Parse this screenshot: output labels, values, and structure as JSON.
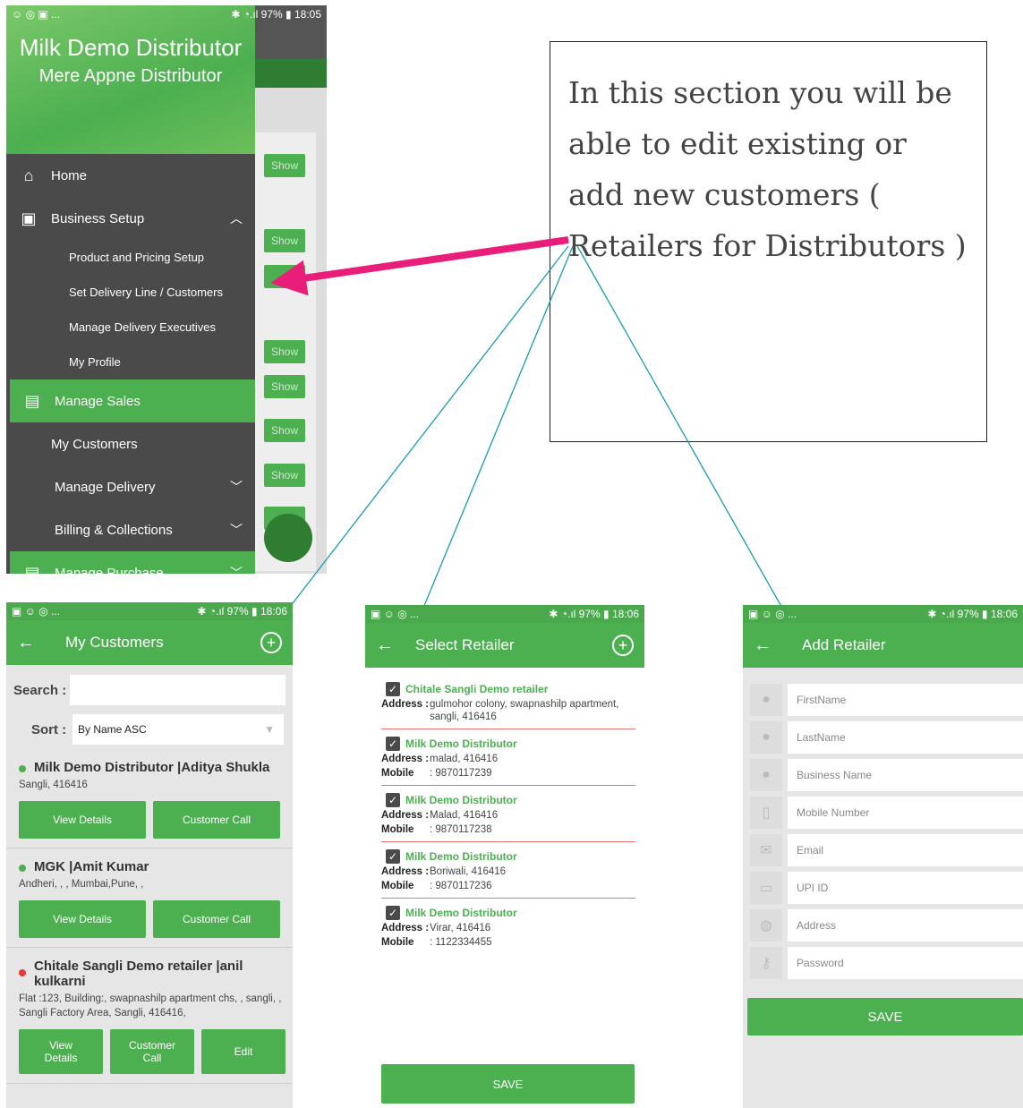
{
  "drawer_screen": {
    "status_left": "☺ ◎ ▣ ...",
    "status_right": "✱ ◔.ıl 97% ▮ 18:05",
    "header_title": "Milk  Demo Distributor",
    "header_subtitle": "Mere Appne Distributor",
    "show_label": "Show",
    "items": {
      "home": "Home",
      "business_setup": "Business Setup",
      "product_pricing": "Product and Pricing Setup",
      "delivery_line": "Set Delivery Line / Customers",
      "delivery_execs": "Manage Delivery Executives",
      "my_profile": "My Profile",
      "manage_sales": "Manage Sales",
      "my_customers": "My Customers",
      "manage_delivery": "Manage Delivery",
      "billing": "Billing & Collections",
      "manage_purchase": "Manage Purchase"
    }
  },
  "note": "In this section you will be able to edit existing or add new customers ( Retailers for Distributors )",
  "customers_screen": {
    "status_left": "▣ ☺ ◎ ...",
    "status_right": "✱ ◔.ıl 97% ▮ 18:06",
    "title": "My Customers",
    "search_label": "Search :",
    "sort_label": "Sort :",
    "sort_value": "By Name ASC",
    "customers": [
      {
        "name": "Milk  Demo Distributor |Aditya Shukla",
        "address": "Sangli, 416416",
        "status_color": "#4caf50",
        "btn1": "View Details",
        "btn2": "Customer Call"
      },
      {
        "name": "MGK |Amit Kumar",
        "address": "Andheri, , , Mumbai,Pune, ,",
        "status_color": "#4caf50",
        "btn1": "View Details",
        "btn2": "Customer Call"
      },
      {
        "name": "Chitale Sangli Demo retailer |anil kulkarni",
        "address": "Flat :123, Building:, swapnashilp apartment chs, , sangli, , Sangli Factory Area, Sangli, 416416,",
        "status_color": "#e53935",
        "btn1": "View\nDetails",
        "btn2": "Customer\nCall",
        "btn3": "Edit"
      }
    ]
  },
  "select_screen": {
    "status_left": "▣ ☺ ◎ ...",
    "status_right": "✱ ◔.ıl 97% ▮ 18:06",
    "title": "Select Retailer",
    "address_label": "Address :",
    "mobile_label": "Mobile",
    "retailers": [
      {
        "name": "Chitale Sangli Demo retailer",
        "address": "gulmohor colony, swapnashilp apartment, sangli, 416416",
        "mobile": ""
      },
      {
        "name": "Milk  Demo Distributor",
        "address": "malad, 416416",
        "mobile": ": 9870117239"
      },
      {
        "name": "Milk  Demo Distributor",
        "address": "Malad, 416416",
        "mobile": ": 9870117238"
      },
      {
        "name": "Milk  Demo Distributor",
        "address": "Boriwali, 416416",
        "mobile": ": 9870117236"
      },
      {
        "name": "Milk  Demo Distributor",
        "address": "Virar, 416416",
        "mobile": ": 1122334455"
      }
    ],
    "save_label": "SAVE"
  },
  "add_screen": {
    "status_left": "▣ ☺ ◎ ...",
    "status_right": "✱ ◔.ıl 97% ▮ 18:06",
    "title": "Add Retailer",
    "fields": [
      "FirstName",
      "LastName",
      "Business Name",
      "Mobile Number",
      "Email",
      "UPI ID",
      "Address",
      "Password"
    ],
    "save_label": "SAVE"
  }
}
